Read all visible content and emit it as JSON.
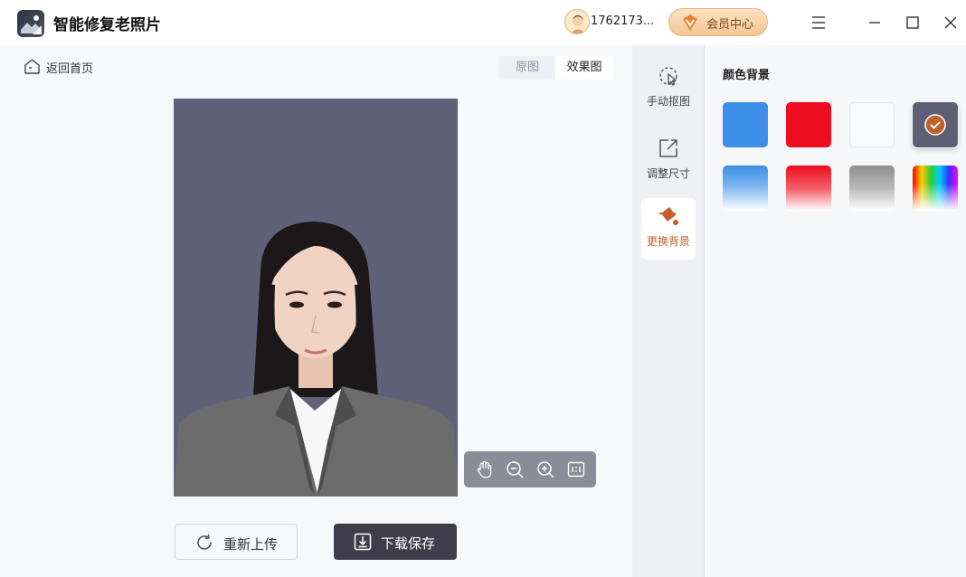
{
  "app": {
    "title": "智能修复老照片"
  },
  "header": {
    "username": "1762173...",
    "vip_label": "会员中心"
  },
  "nav": {
    "back_label": "返回首页"
  },
  "view_tabs": {
    "original": "原图",
    "effect": "效果图"
  },
  "actions": {
    "reupload": "重新上传",
    "download": "下载保存"
  },
  "tool_rail": {
    "items": [
      {
        "label": "手动抠图",
        "icon": "cursor-select-icon"
      },
      {
        "label": "调整尺寸",
        "icon": "resize-icon"
      },
      {
        "label": "更换背景",
        "icon": "paint-bucket-icon",
        "active": true
      }
    ]
  },
  "bg_panel": {
    "title": "颜色背景",
    "swatches": [
      {
        "name": "blue",
        "color": "#3d8ee6"
      },
      {
        "name": "red",
        "color": "#ee0d1e"
      },
      {
        "name": "white",
        "color": "#f9fafc"
      },
      {
        "name": "dark-gray",
        "color": "#5d5f75",
        "selected": true
      },
      {
        "name": "blue-gradient",
        "color": "#3d8ee6"
      },
      {
        "name": "red-gradient",
        "color": "#ee0d1e"
      },
      {
        "name": "gray-gradient",
        "color": "#8e8e8e"
      },
      {
        "name": "rainbow-gradient",
        "color": "rainbow"
      }
    ]
  },
  "photo": {
    "background_color": "#606079"
  },
  "colors": {
    "accent": "#c0602a",
    "download_button": "#3f3d4b"
  }
}
